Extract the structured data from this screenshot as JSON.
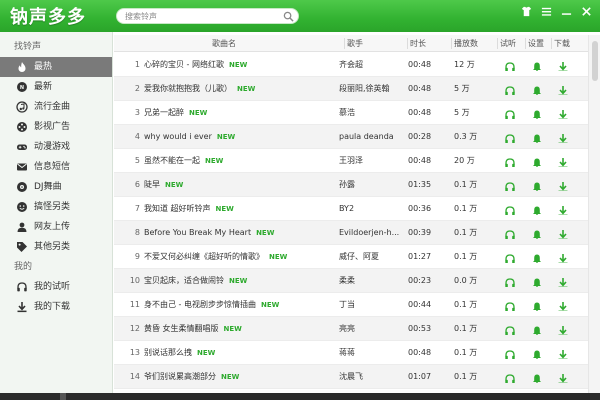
{
  "app": {
    "title": "钠声多多"
  },
  "search": {
    "placeholder": "搜索铃声"
  },
  "sidebar": {
    "sections": [
      {
        "label": "找铃声"
      },
      {
        "label": "我的"
      }
    ],
    "find_items": [
      {
        "label": "最热",
        "icon": "flame-icon",
        "active": true
      },
      {
        "label": "最新",
        "icon": "new-icon"
      },
      {
        "label": "流行金曲",
        "icon": "music-note-icon"
      },
      {
        "label": "影视广告",
        "icon": "film-icon"
      },
      {
        "label": "动漫游戏",
        "icon": "gamepad-icon"
      },
      {
        "label": "信息短信",
        "icon": "message-icon"
      },
      {
        "label": "DJ舞曲",
        "icon": "disc-icon"
      },
      {
        "label": "搞怪另类",
        "icon": "funny-icon"
      },
      {
        "label": "网友上传",
        "icon": "user-icon"
      },
      {
        "label": "其他另类",
        "icon": "tag-icon"
      }
    ],
    "my_items": [
      {
        "label": "我的试听",
        "icon": "headphones-icon"
      },
      {
        "label": "我的下载",
        "icon": "download-icon"
      }
    ]
  },
  "table": {
    "headers": {
      "name": "歌曲名",
      "singer": "歌手",
      "duration": "时长",
      "plays": "播放数",
      "listen": "试听",
      "settings": "设置",
      "download": "下载"
    },
    "new_label": "NEW",
    "rows": [
      {
        "idx": "1",
        "name": "心碎的宝贝 - 网络红歌",
        "new": true,
        "singer": "齐会超",
        "duration": "00:48",
        "plays": "12 万"
      },
      {
        "idx": "2",
        "name": "爱我你就抱抱我（儿歌）",
        "new": true,
        "singer": "段丽阳,徐英翰",
        "duration": "00:48",
        "plays": "5 万"
      },
      {
        "idx": "3",
        "name": "兄弟一起醉",
        "new": true,
        "singer": "慕浩",
        "duration": "00:48",
        "plays": "5 万"
      },
      {
        "idx": "4",
        "name": "why would i ever",
        "new": true,
        "singer": "paula deanda",
        "duration": "00:28",
        "plays": "0.3 万"
      },
      {
        "idx": "5",
        "name": "虽然不能在一起",
        "new": true,
        "singer": "王羽泽",
        "duration": "00:48",
        "plays": "20 万"
      },
      {
        "idx": "6",
        "name": "陡早",
        "new": true,
        "singer": "孙露",
        "duration": "01:35",
        "plays": "0.1 万"
      },
      {
        "idx": "7",
        "name": "我知道  超好听铃声",
        "new": true,
        "singer": "BY2",
        "duration": "00:36",
        "plays": "0.1 万"
      },
      {
        "idx": "8",
        "name": "Before You Break My Heart",
        "new": true,
        "singer": "Evildoerjen-h...",
        "duration": "00:39",
        "plays": "0.1 万"
      },
      {
        "idx": "9",
        "name": "不爱又何必纠缠《超好听的情歌》",
        "new": true,
        "singer": "威仔、阿夏",
        "duration": "01:27",
        "plays": "0.1 万"
      },
      {
        "idx": "10",
        "name": "宝贝起床，适合做闹铃",
        "new": true,
        "singer": "柔柔",
        "duration": "00:23",
        "plays": "0.0 万"
      },
      {
        "idx": "11",
        "name": "身不由己 - 电视剧步步惊情插曲",
        "new": true,
        "singer": "丁当",
        "duration": "00:44",
        "plays": "0.1 万"
      },
      {
        "idx": "12",
        "name": "黄昏 女生柔情翻唱版",
        "new": true,
        "singer": "亮亮",
        "duration": "00:53",
        "plays": "0.1 万"
      },
      {
        "idx": "13",
        "name": "别说话那么拽",
        "new": true,
        "singer": "蒋蒋",
        "duration": "00:48",
        "plays": "0.1 万"
      },
      {
        "idx": "14",
        "name": "爷们别说累高潮部分",
        "new": true,
        "singer": "沈晨飞",
        "duration": "01:07",
        "plays": "0.1 万"
      }
    ]
  },
  "colors": {
    "brand": "#32b231",
    "accent": "#2eaa2e",
    "active_item": "#7a7a7a"
  }
}
